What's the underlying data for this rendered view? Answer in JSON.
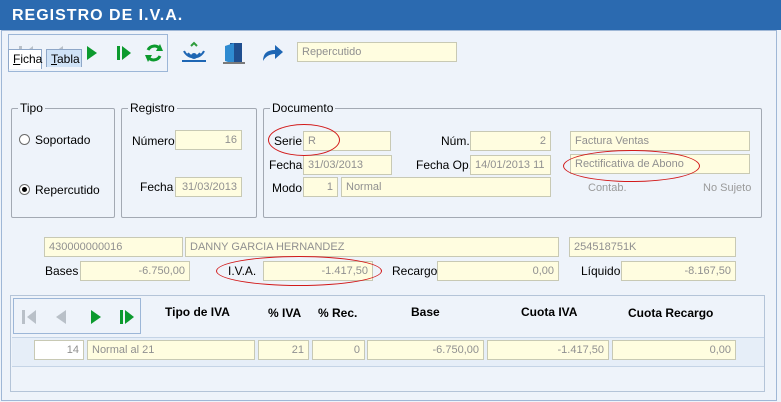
{
  "window": {
    "title": "REGISTRO DE I.V.A."
  },
  "toolbar": {
    "mode_value": "Repercutido"
  },
  "tabs": [
    {
      "label_u": "F",
      "label_rest": "icha"
    },
    {
      "label_u": "T",
      "label_rest": "abla"
    }
  ],
  "tipo": {
    "title": "Tipo",
    "opt1": "Soportado",
    "opt2": "Repercutido",
    "selected": "Repercutido"
  },
  "registro": {
    "title": "Registro",
    "numero_label": "Número",
    "numero": "16",
    "fecha_label": "Fecha",
    "fecha": "31/03/2013"
  },
  "documento": {
    "title": "Documento",
    "serie_label": "Serie",
    "serie": "R",
    "num_label": "Núm.",
    "num": "2",
    "fecha_label": "Fecha",
    "fecha": "31/03/2013",
    "fechaop_label": "Fecha Op.",
    "fechaop": "14/01/2013 11",
    "modo_label": "Modo",
    "modo_code": "1",
    "modo_desc": "Normal",
    "tipo_factura": "Factura Ventas",
    "rectificativa": "Rectificativa de Abono",
    "contab_label": "Contab.",
    "no_sujeto_label": "No Sujeto"
  },
  "cliente": {
    "cuenta": "430000000016",
    "nombre": "DANNY GARCIA HERNANDEZ",
    "nif": "254518751K"
  },
  "totales": {
    "bases_label": "Bases",
    "bases": "-6.750,00",
    "iva_label": "I.V.A.",
    "iva": "-1.417,50",
    "recargo_label": "Recargo",
    "recargo": "0,00",
    "liquido_label": "Líquido",
    "liquido": "-8.167,50"
  },
  "grid": {
    "headers": {
      "tipo": "Tipo de IVA",
      "piva": "% IVA",
      "prec": "% Rec.",
      "base": "Base",
      "cuota": "Cuota IVA",
      "cuota_rec": "Cuota Recargo"
    },
    "rows": [
      {
        "code": "14",
        "tipo": "Normal al 21",
        "piva": "21",
        "prec": "0",
        "base": "-6.750,00",
        "cuota": "-1.417,50",
        "cuota_rec": "0,00"
      }
    ]
  },
  "colors": {
    "title_bar": "#2b6ab0",
    "field_bg": "#fffde0",
    "nav_green": "#0c9a2e",
    "annotation_red": "#d21a1a"
  },
  "icons": [
    "first-icon",
    "prev-icon",
    "next-icon",
    "last-icon",
    "refresh-icon",
    "antenna-icon",
    "exit-door-icon",
    "forward-arrow-icon"
  ]
}
